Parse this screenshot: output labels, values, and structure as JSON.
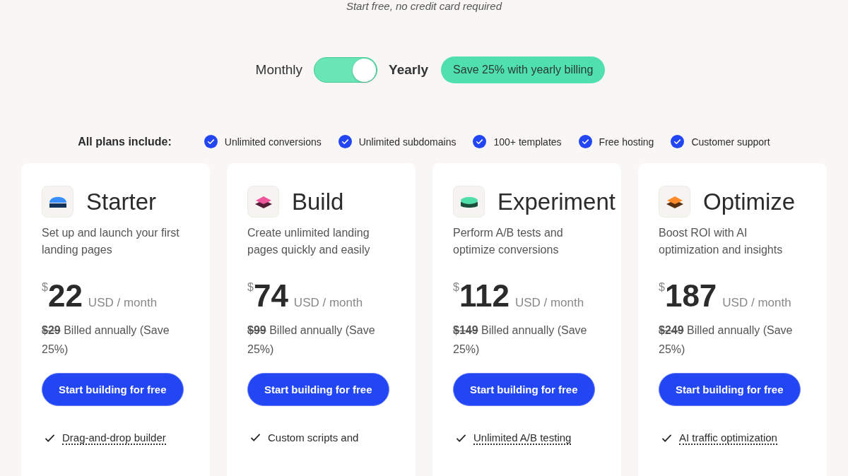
{
  "subtitle": "Start free, no credit card required",
  "billing": {
    "options": [
      {
        "label": "Monthly",
        "selected": false
      },
      {
        "label": "Yearly",
        "selected": true
      }
    ],
    "toggle_on": true,
    "badge": "Save 25% with yearly billing"
  },
  "includes": {
    "label": "All plans include:",
    "items": [
      "Unlimited conversions",
      "Unlimited subdomains",
      "100+ templates",
      "Free hosting",
      "Customer support"
    ]
  },
  "plans": [
    {
      "name": "Starter",
      "icon": {
        "kind": "dome",
        "color": "#3a8dff"
      },
      "description": "Set up and launch your first landing pages",
      "currency": "$",
      "price": "22",
      "period": "USD / month",
      "old_price": "$29",
      "billing_note": "Billed annually (Save 25%)",
      "button": "Start building for free",
      "features": [
        {
          "text": "Drag-and-drop builder",
          "underlined": true
        }
      ]
    },
    {
      "name": "Build",
      "icon": {
        "kind": "stack",
        "color": "#f0569b"
      },
      "description": "Create unlimited landing pages quickly and easily",
      "currency": "$",
      "price": "74",
      "period": "USD / month",
      "old_price": "$99",
      "billing_note": "Billed annually (Save 25%)",
      "button": "Start building for free",
      "features": [
        {
          "text": "Custom scripts and",
          "underlined": false
        }
      ]
    },
    {
      "name": "Experiment",
      "icon": {
        "kind": "disc",
        "color": "#4fdfa9"
      },
      "description": "Perform A/B tests and optimize conversions",
      "currency": "$",
      "price": "112",
      "period": "USD / month",
      "old_price": "$149",
      "billing_note": "Billed annually (Save 25%)",
      "button": "Start building for free",
      "features": [
        {
          "text": "Unlimited A/B testing",
          "underlined": true
        }
      ]
    },
    {
      "name": "Optimize",
      "icon": {
        "kind": "stack",
        "color": "#ff8a2a"
      },
      "description": "Boost ROI with AI optimization and insights",
      "currency": "$",
      "price": "187",
      "period": "USD / month",
      "old_price": "$249",
      "billing_note": "Billed annually (Save 25%)",
      "button": "Start building for free",
      "features": [
        {
          "text": "AI traffic optimization",
          "underlined": true
        }
      ]
    }
  ]
}
